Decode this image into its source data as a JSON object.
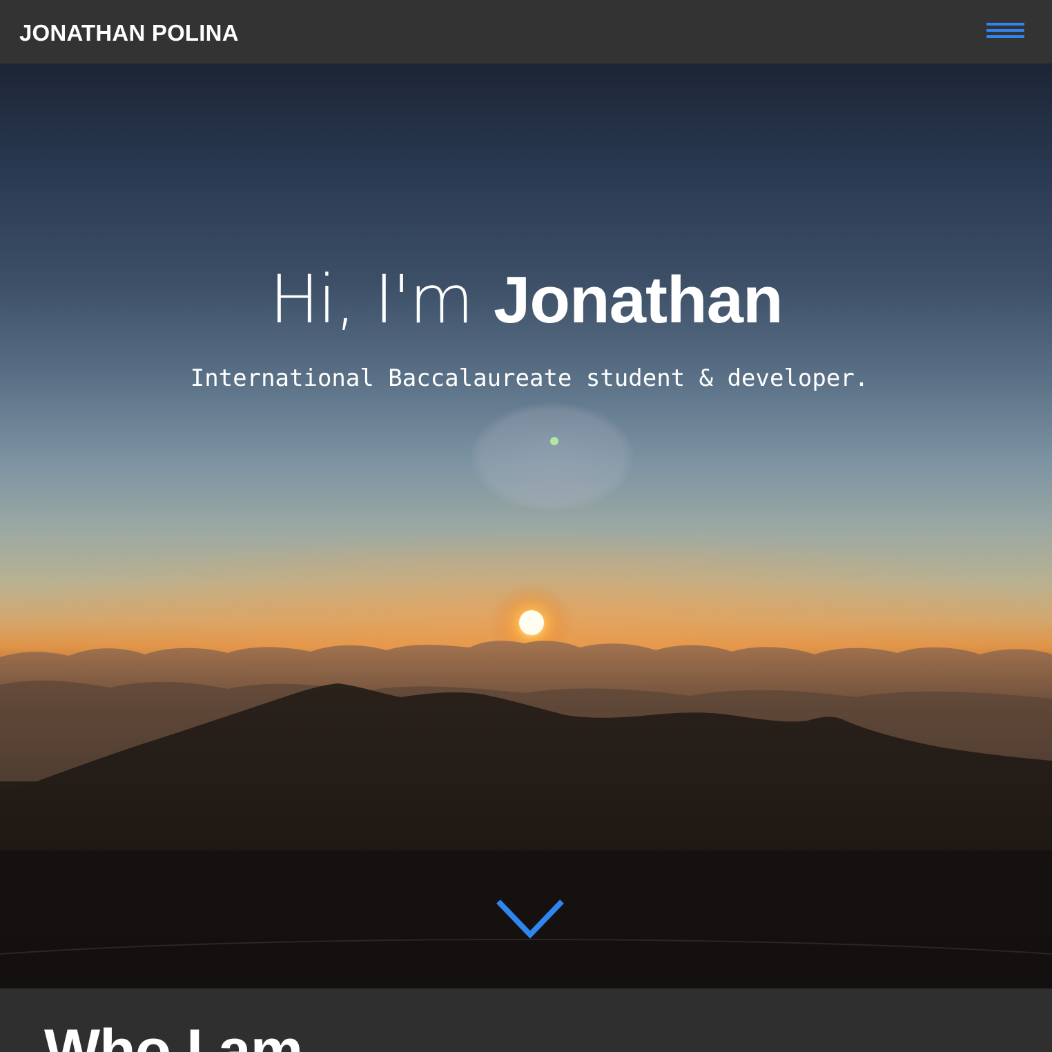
{
  "navbar": {
    "brand": "JONATHAN POLINA",
    "menu_icon": "hamburger-menu-icon",
    "accent_color": "#2f86f0"
  },
  "hero": {
    "greeting": "Hi, I'm",
    "name": "Jonathan",
    "tagline": "International Baccalaureate student & developer.",
    "background": "sunset-over-clouds-and-mountains",
    "scroll_icon": "chevron-down-icon"
  },
  "about": {
    "title": "Who I am"
  }
}
